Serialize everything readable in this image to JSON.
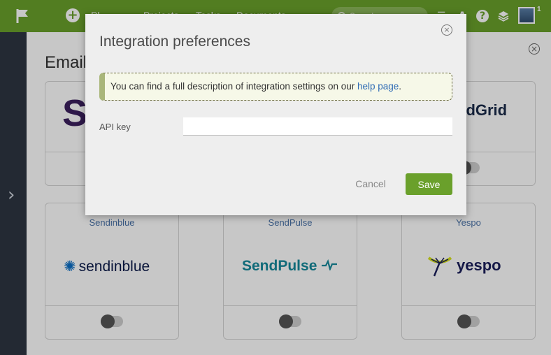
{
  "topbar": {
    "nav": [
      "Pl",
      "Projects",
      "Tasks",
      "Documents"
    ],
    "search_placeholder": "Search",
    "avatar_badge": "1"
  },
  "panel": {
    "title": "Email",
    "partial_logo_left": "S",
    "partial_logo_right": "ndGrid"
  },
  "cards": [
    {
      "name": "Sendinblue",
      "logo_text": "sendinblue",
      "enabled": false
    },
    {
      "name": "SendPulse",
      "logo_text": "SendPulse",
      "enabled": false
    },
    {
      "name": "Yespo",
      "logo_text": "yespo",
      "enabled": false
    }
  ],
  "modal": {
    "title": "Integration preferences",
    "info_text": "You can find a full description of integration settings on our ",
    "info_link": "help page",
    "info_suffix": ".",
    "api_label": "API key",
    "api_value": "",
    "cancel_label": "Cancel",
    "save_label": "Save"
  },
  "colors": {
    "brand_green": "#6aa02b",
    "sidebar_dark": "#2d3542",
    "link_blue": "#2d6ab4"
  }
}
